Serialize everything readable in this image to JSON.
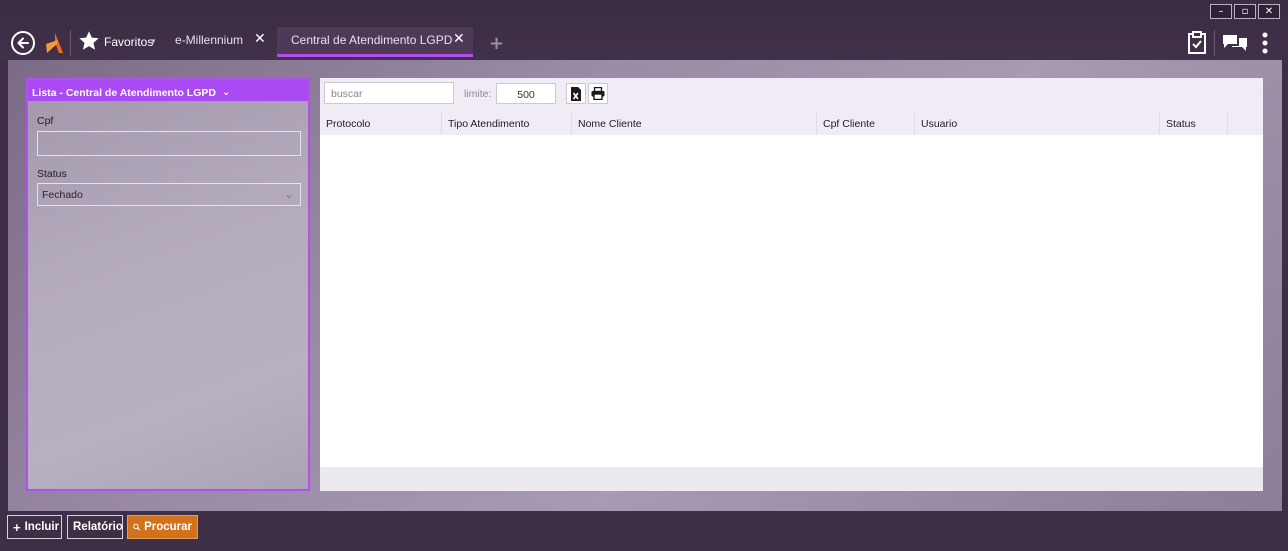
{
  "titlebar": {
    "favorites_label": "Favoritos",
    "favorites_caret": "▾",
    "tabs": [
      {
        "label": "e-Millennium",
        "close": "✕"
      },
      {
        "label": "Central de Atendimento LGPD",
        "close": "✕"
      }
    ],
    "add_tab": "+",
    "window_controls": {
      "minimize": "–",
      "maximize": "▫",
      "close": "✕"
    }
  },
  "left_panel": {
    "title": "Lista - Central de Atendimento LGPD",
    "chevron": "⌄",
    "cpf_label": "Cpf",
    "cpf_value": "",
    "status_label": "Status",
    "status_value": "Fechado",
    "status_caret": "⌄"
  },
  "grid": {
    "search_placeholder": "buscar",
    "limit_label": "limite:",
    "limit_value": "500",
    "columns": [
      "Protocolo",
      "Tipo Atendimento",
      "Nome Cliente",
      "Cpf Cliente",
      "Usuario",
      "Status"
    ]
  },
  "bottom_bar": {
    "incluir_icon": "+",
    "incluir": "Incluir",
    "relatorio": "Relatório",
    "procurar": "Procurar"
  },
  "colors": {
    "accent": "#a94af2",
    "procurar": "#d2721b",
    "titlebar": "#3d2f45",
    "logo": "#f26a1b"
  },
  "icons": [
    "back-arrow-icon",
    "logo-icon",
    "star-icon",
    "excel-icon",
    "print-icon",
    "clipboard-check-icon",
    "chat-icon",
    "more-vertical-icon",
    "search-icon"
  ]
}
